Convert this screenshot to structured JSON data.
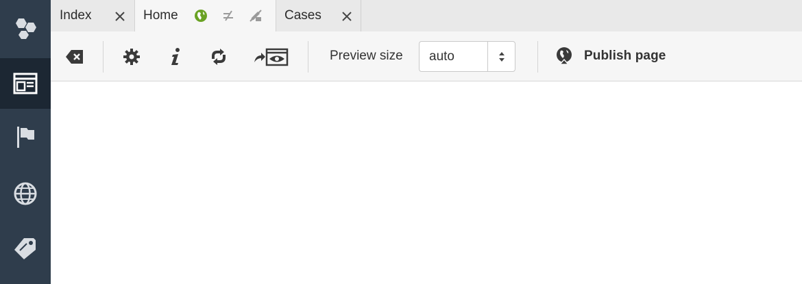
{
  "sidebar": {
    "items": [
      {
        "icon": "hexagons-logo-icon"
      },
      {
        "icon": "browser-window-icon",
        "active": true
      },
      {
        "icon": "flag-icon"
      },
      {
        "icon": "globe-icon"
      },
      {
        "icon": "tag-icon"
      }
    ]
  },
  "tabs": [
    {
      "label": "Index"
    },
    {
      "label": "Home",
      "active": true
    },
    {
      "label": "Cases"
    }
  ],
  "toolbar": {
    "preview_size_label": "Preview size",
    "preview_size_value": "auto",
    "publish_label": "Publish page"
  },
  "colors": {
    "sidebar_bg": "#2f3d4c",
    "sidebar_active_bg": "#1c2733",
    "published_green": "#6aa224",
    "icon_dark": "#3a3a3a"
  }
}
